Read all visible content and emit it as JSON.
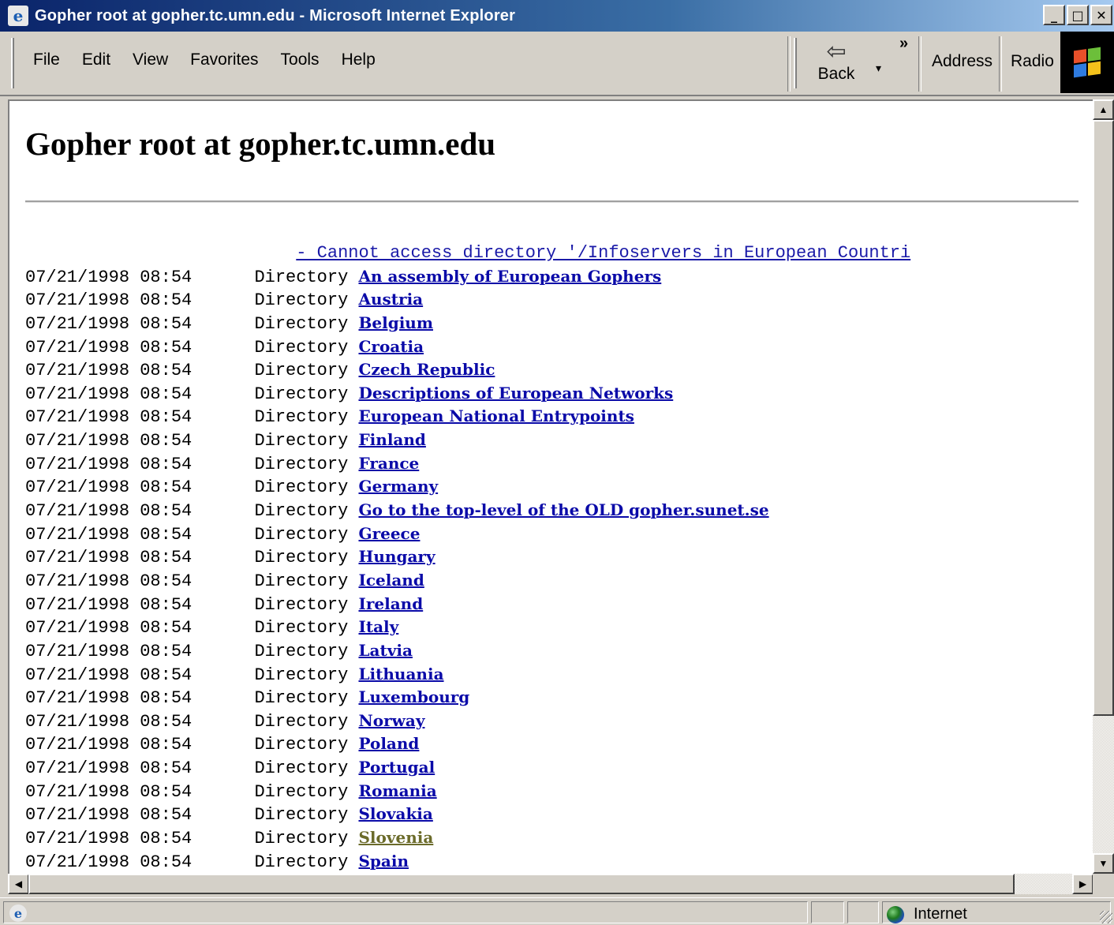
{
  "window": {
    "title": "Gopher root at gopher.tc.umn.edu - Microsoft Internet Explorer",
    "buttons": {
      "minimize": "_",
      "maximize": "□",
      "close": "✕"
    }
  },
  "menu": [
    "File",
    "Edit",
    "View",
    "Favorites",
    "Tools",
    "Help"
  ],
  "toolbar": {
    "back_label": "Back",
    "back_arrow": "⇦",
    "dropdown": "▾",
    "more": "»",
    "address_label": "Address",
    "radio_label": "Radio"
  },
  "page": {
    "heading": "Gopher root at gopher.tc.umn.edu",
    "error_line": "- Cannot access directory '/Infoservers in European Countri",
    "entries": [
      {
        "datetime": "07/21/1998 08:54",
        "type": "Directory",
        "name": "An assembly of European Gophers"
      },
      {
        "datetime": "07/21/1998 08:54",
        "type": "Directory",
        "name": "Austria"
      },
      {
        "datetime": "07/21/1998 08:54",
        "type": "Directory",
        "name": "Belgium"
      },
      {
        "datetime": "07/21/1998 08:54",
        "type": "Directory",
        "name": "Croatia"
      },
      {
        "datetime": "07/21/1998 08:54",
        "type": "Directory",
        "name": "Czech Republic"
      },
      {
        "datetime": "07/21/1998 08:54",
        "type": "Directory",
        "name": "Descriptions of European Networks"
      },
      {
        "datetime": "07/21/1998 08:54",
        "type": "Directory",
        "name": "European National Entrypoints"
      },
      {
        "datetime": "07/21/1998 08:54",
        "type": "Directory",
        "name": "Finland"
      },
      {
        "datetime": "07/21/1998 08:54",
        "type": "Directory",
        "name": "France"
      },
      {
        "datetime": "07/21/1998 08:54",
        "type": "Directory",
        "name": "Germany"
      },
      {
        "datetime": "07/21/1998 08:54",
        "type": "Directory",
        "name": "Go to the top-level of the OLD gopher.sunet.se"
      },
      {
        "datetime": "07/21/1998 08:54",
        "type": "Directory",
        "name": "Greece"
      },
      {
        "datetime": "07/21/1998 08:54",
        "type": "Directory",
        "name": "Hungary"
      },
      {
        "datetime": "07/21/1998 08:54",
        "type": "Directory",
        "name": "Iceland"
      },
      {
        "datetime": "07/21/1998 08:54",
        "type": "Directory",
        "name": "Ireland"
      },
      {
        "datetime": "07/21/1998 08:54",
        "type": "Directory",
        "name": "Italy"
      },
      {
        "datetime": "07/21/1998 08:54",
        "type": "Directory",
        "name": "Latvia"
      },
      {
        "datetime": "07/21/1998 08:54",
        "type": "Directory",
        "name": "Lithuania"
      },
      {
        "datetime": "07/21/1998 08:54",
        "type": "Directory",
        "name": "Luxembourg"
      },
      {
        "datetime": "07/21/1998 08:54",
        "type": "Directory",
        "name": "Norway"
      },
      {
        "datetime": "07/21/1998 08:54",
        "type": "Directory",
        "name": "Poland"
      },
      {
        "datetime": "07/21/1998 08:54",
        "type": "Directory",
        "name": "Portugal"
      },
      {
        "datetime": "07/21/1998 08:54",
        "type": "Directory",
        "name": "Romania"
      },
      {
        "datetime": "07/21/1998 08:54",
        "type": "Directory",
        "name": "Slovakia"
      },
      {
        "datetime": "07/21/1998 08:54",
        "type": "Directory",
        "name": "Slovenia",
        "visited": true
      },
      {
        "datetime": "07/21/1998 08:54",
        "type": "Directory",
        "name": "Spain"
      }
    ]
  },
  "status": {
    "zone": "Internet"
  },
  "colors": {
    "link": "#0a0aa8",
    "visited_link": "#6b6b2a",
    "titlebar_start": "#0a246a",
    "chrome": "#d4d0c8"
  }
}
